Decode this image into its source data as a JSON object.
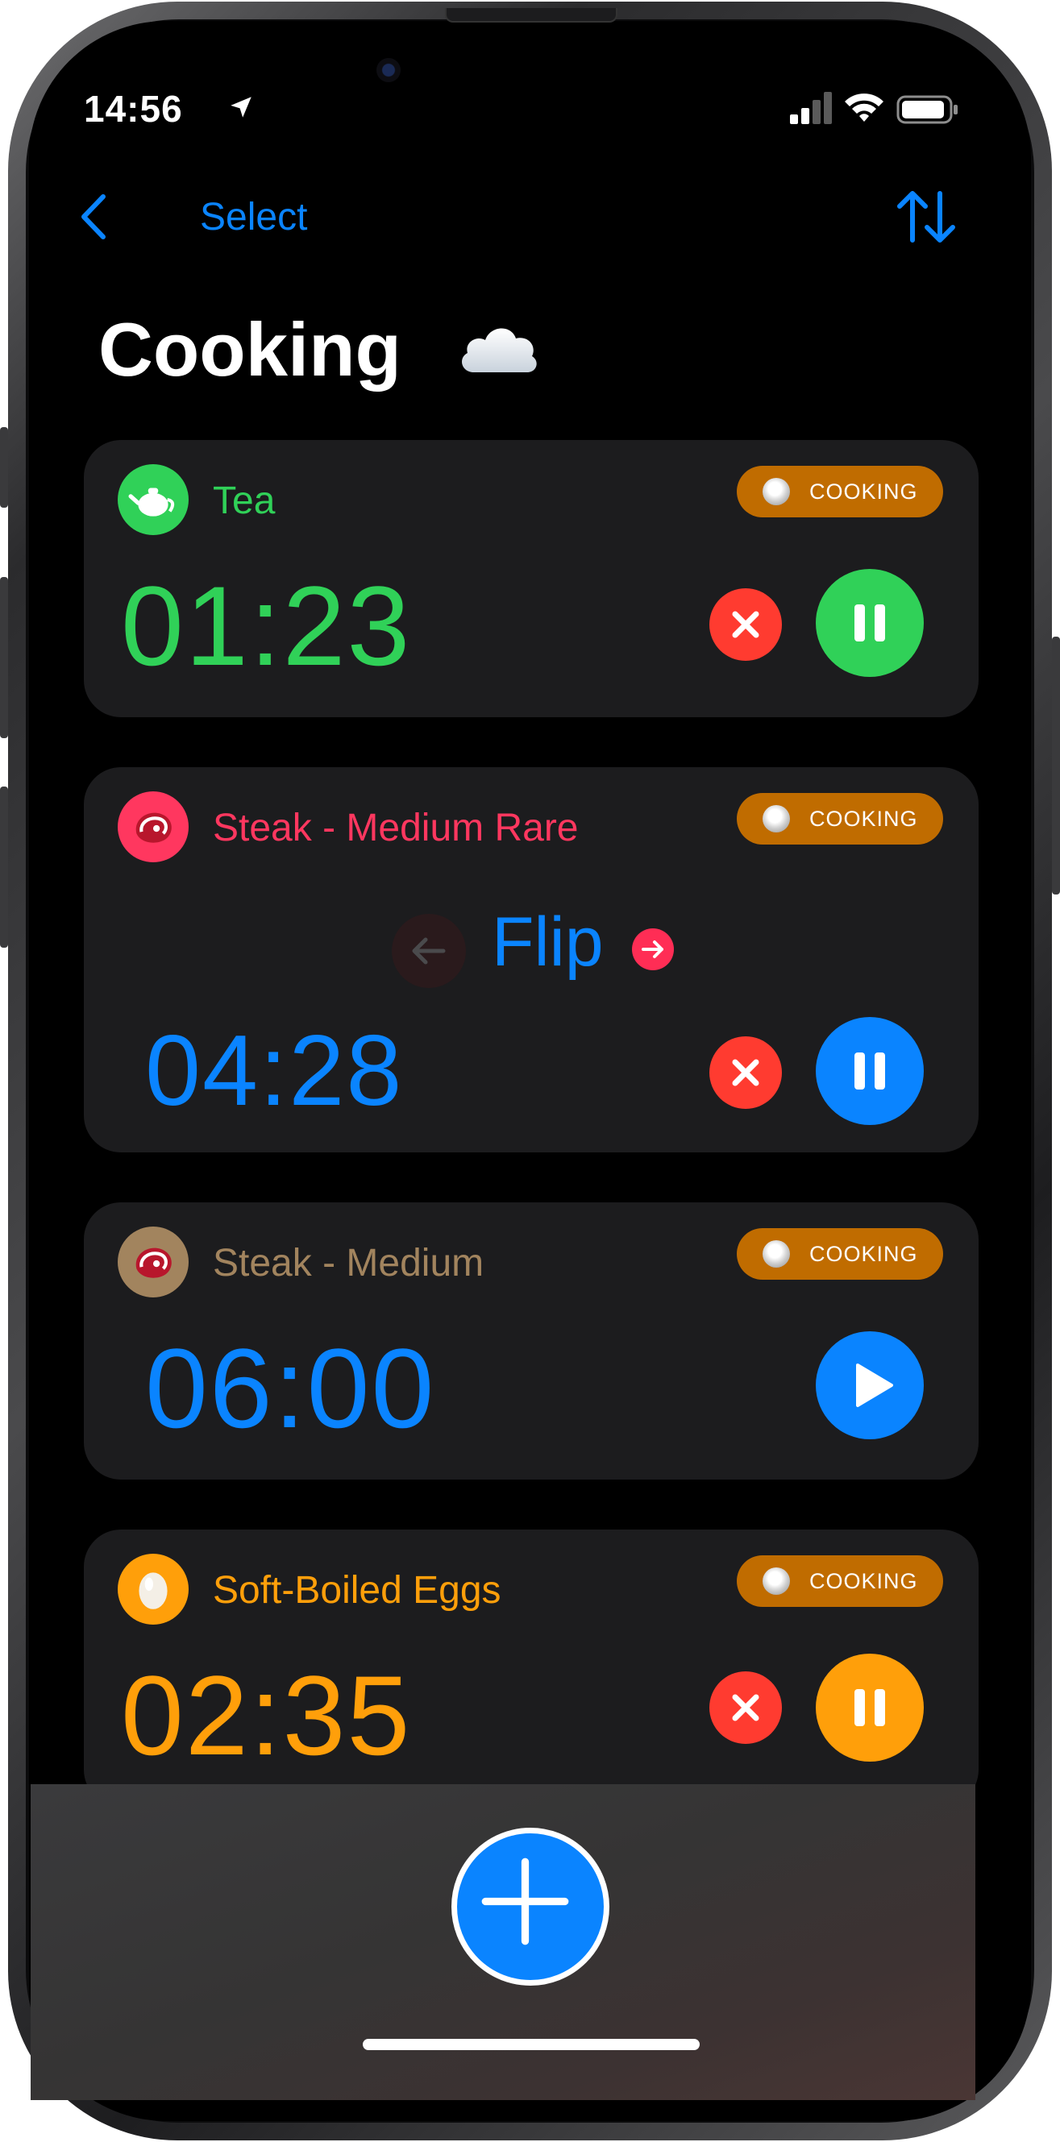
{
  "status_bar": {
    "time": "14:56"
  },
  "nav": {
    "select_label": "Select"
  },
  "page": {
    "title": "Cooking"
  },
  "timers": [
    {
      "name": "Tea",
      "status": "COOKING",
      "time": "01:23",
      "color": "#30d158",
      "state": "running",
      "icon": "teapot-icon"
    },
    {
      "name": "Steak - Medium Rare",
      "status": "COOKING",
      "time": "04:28",
      "color": "#ff375f",
      "time_color": "#0a84ff",
      "state": "running",
      "icon": "steak-icon",
      "step": "Flip"
    },
    {
      "name": "Steak - Medium",
      "status": "COOKING",
      "time": "06:00",
      "color": "#a2845e",
      "time_color": "#0a84ff",
      "state": "paused",
      "icon": "steak-icon"
    },
    {
      "name": "Soft-Boiled Eggs",
      "status": "COOKING",
      "time": "02:35",
      "color": "#ff9f0a",
      "state": "running",
      "icon": "egg-icon"
    }
  ],
  "colors": {
    "accent": "#0a84ff",
    "danger": "#ff3b30",
    "badge": "#c06c00",
    "card": "#1c1c1e"
  }
}
